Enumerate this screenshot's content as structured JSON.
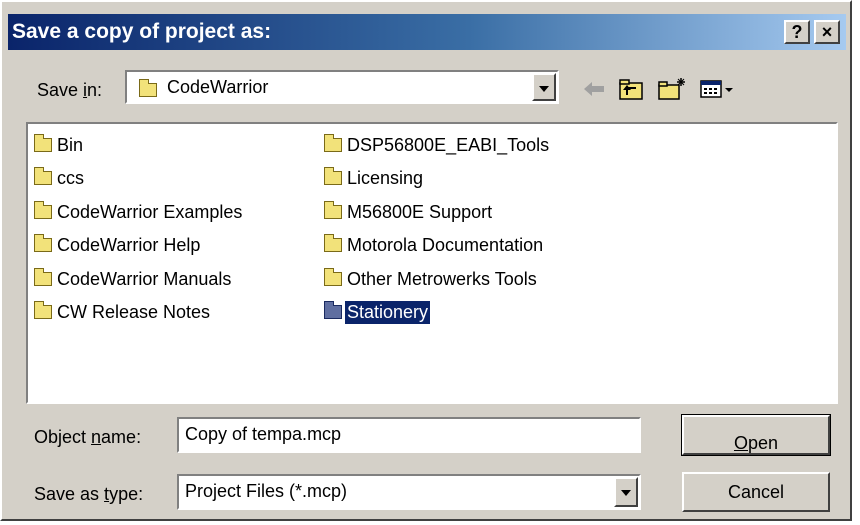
{
  "window": {
    "title": "Save a copy of project as:",
    "help_label": "?",
    "close_label": "×"
  },
  "save_in": {
    "label_prefix": "Save ",
    "label_accel": "i",
    "label_suffix": "n:",
    "value": "CodeWarrior"
  },
  "toolbar": {
    "back_icon": "back-arrow-icon",
    "up_icon": "up-folder-icon",
    "new_folder_icon": "new-folder-icon",
    "view_icon": "view-menu-icon"
  },
  "files": {
    "column1": [
      "Bin",
      "ccs",
      "CodeWarrior Examples",
      "CodeWarrior Help",
      "CodeWarrior Manuals",
      "CW Release Notes"
    ],
    "column2": [
      "DSP56800E_EABI_Tools",
      "Licensing",
      "M56800E Support",
      "Motorola Documentation",
      "Other Metrowerks Tools",
      "Stationery"
    ],
    "selected": "Stationery"
  },
  "object_name": {
    "label_prefix": "Object ",
    "label_accel": "n",
    "label_suffix": "ame:",
    "value": "Copy of  tempa.mcp"
  },
  "save_as_type": {
    "label_prefix": "Save as ",
    "label_accel": "t",
    "label_suffix": "ype:",
    "value": "Project Files (*.mcp)"
  },
  "buttons": {
    "open_accel": "O",
    "open_rest": "pen",
    "cancel": "Cancel"
  },
  "colors": {
    "title_gradient_start": "#0a246a",
    "title_gradient_end": "#a6caf0",
    "face": "#d4d0c8",
    "selection": "#0a246a"
  }
}
